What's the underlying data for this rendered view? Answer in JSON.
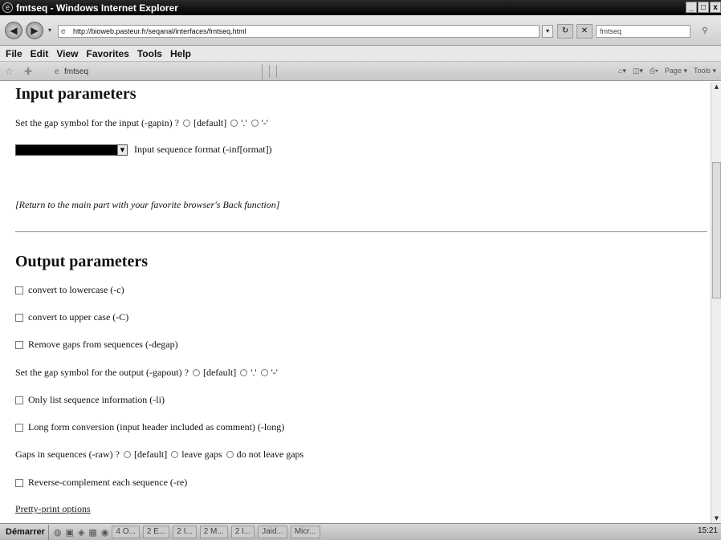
{
  "window": {
    "title": "fmtseq - Windows Internet Explorer",
    "min": "_",
    "max": "□",
    "close": "x"
  },
  "address": {
    "url": "http://bioweb.pasteur.fr/seqanal/interfaces/fmtseq.html",
    "search_value": "fmtseq"
  },
  "menu": [
    "File",
    "Edit",
    "View",
    "Favorites",
    "Tools",
    "Help"
  ],
  "tab": {
    "label": "fmtseq"
  },
  "toolbar": {
    "page": "Page ▾",
    "tools": "Tools ▾"
  },
  "input_section": {
    "heading": "Input parameters",
    "gap_label": "Set the gap symbol for the input (-gapin) ?",
    "gap_options": [
      "[default]",
      "'.'",
      "'-'"
    ],
    "format_label": "Input sequence format (-inf[ormat])",
    "return_text": "[Return to the main part with your favorite browser's Back function]"
  },
  "output_section": {
    "heading": "Output parameters",
    "lowercase": "convert to lowercase (-c)",
    "uppercase": "convert to upper case (-C)",
    "degap": "Remove gaps from sequences (-degap)",
    "gapout_label": "Set the gap symbol for the output (-gapout) ?",
    "gapout_options": [
      "[default]",
      "'.'",
      "'-'"
    ],
    "list_info": "Only list sequence information (-li)",
    "long_form": "Long form conversion (input header included as comment) (-long)",
    "raw_label": "Gaps in sequences (-raw) ?",
    "raw_options": [
      "[default]",
      "leave gaps",
      "do not leave gaps"
    ],
    "reverse": "Reverse-complement each sequence (-re)",
    "pretty_link": "Pretty-print options"
  },
  "taskbar": {
    "start": "Démarrer",
    "items": [
      "4 O...",
      "2 E...",
      "2 I...",
      "2 M...",
      "2 I...",
      "Jaid...",
      "Micr..."
    ],
    "clock": "15:21"
  }
}
